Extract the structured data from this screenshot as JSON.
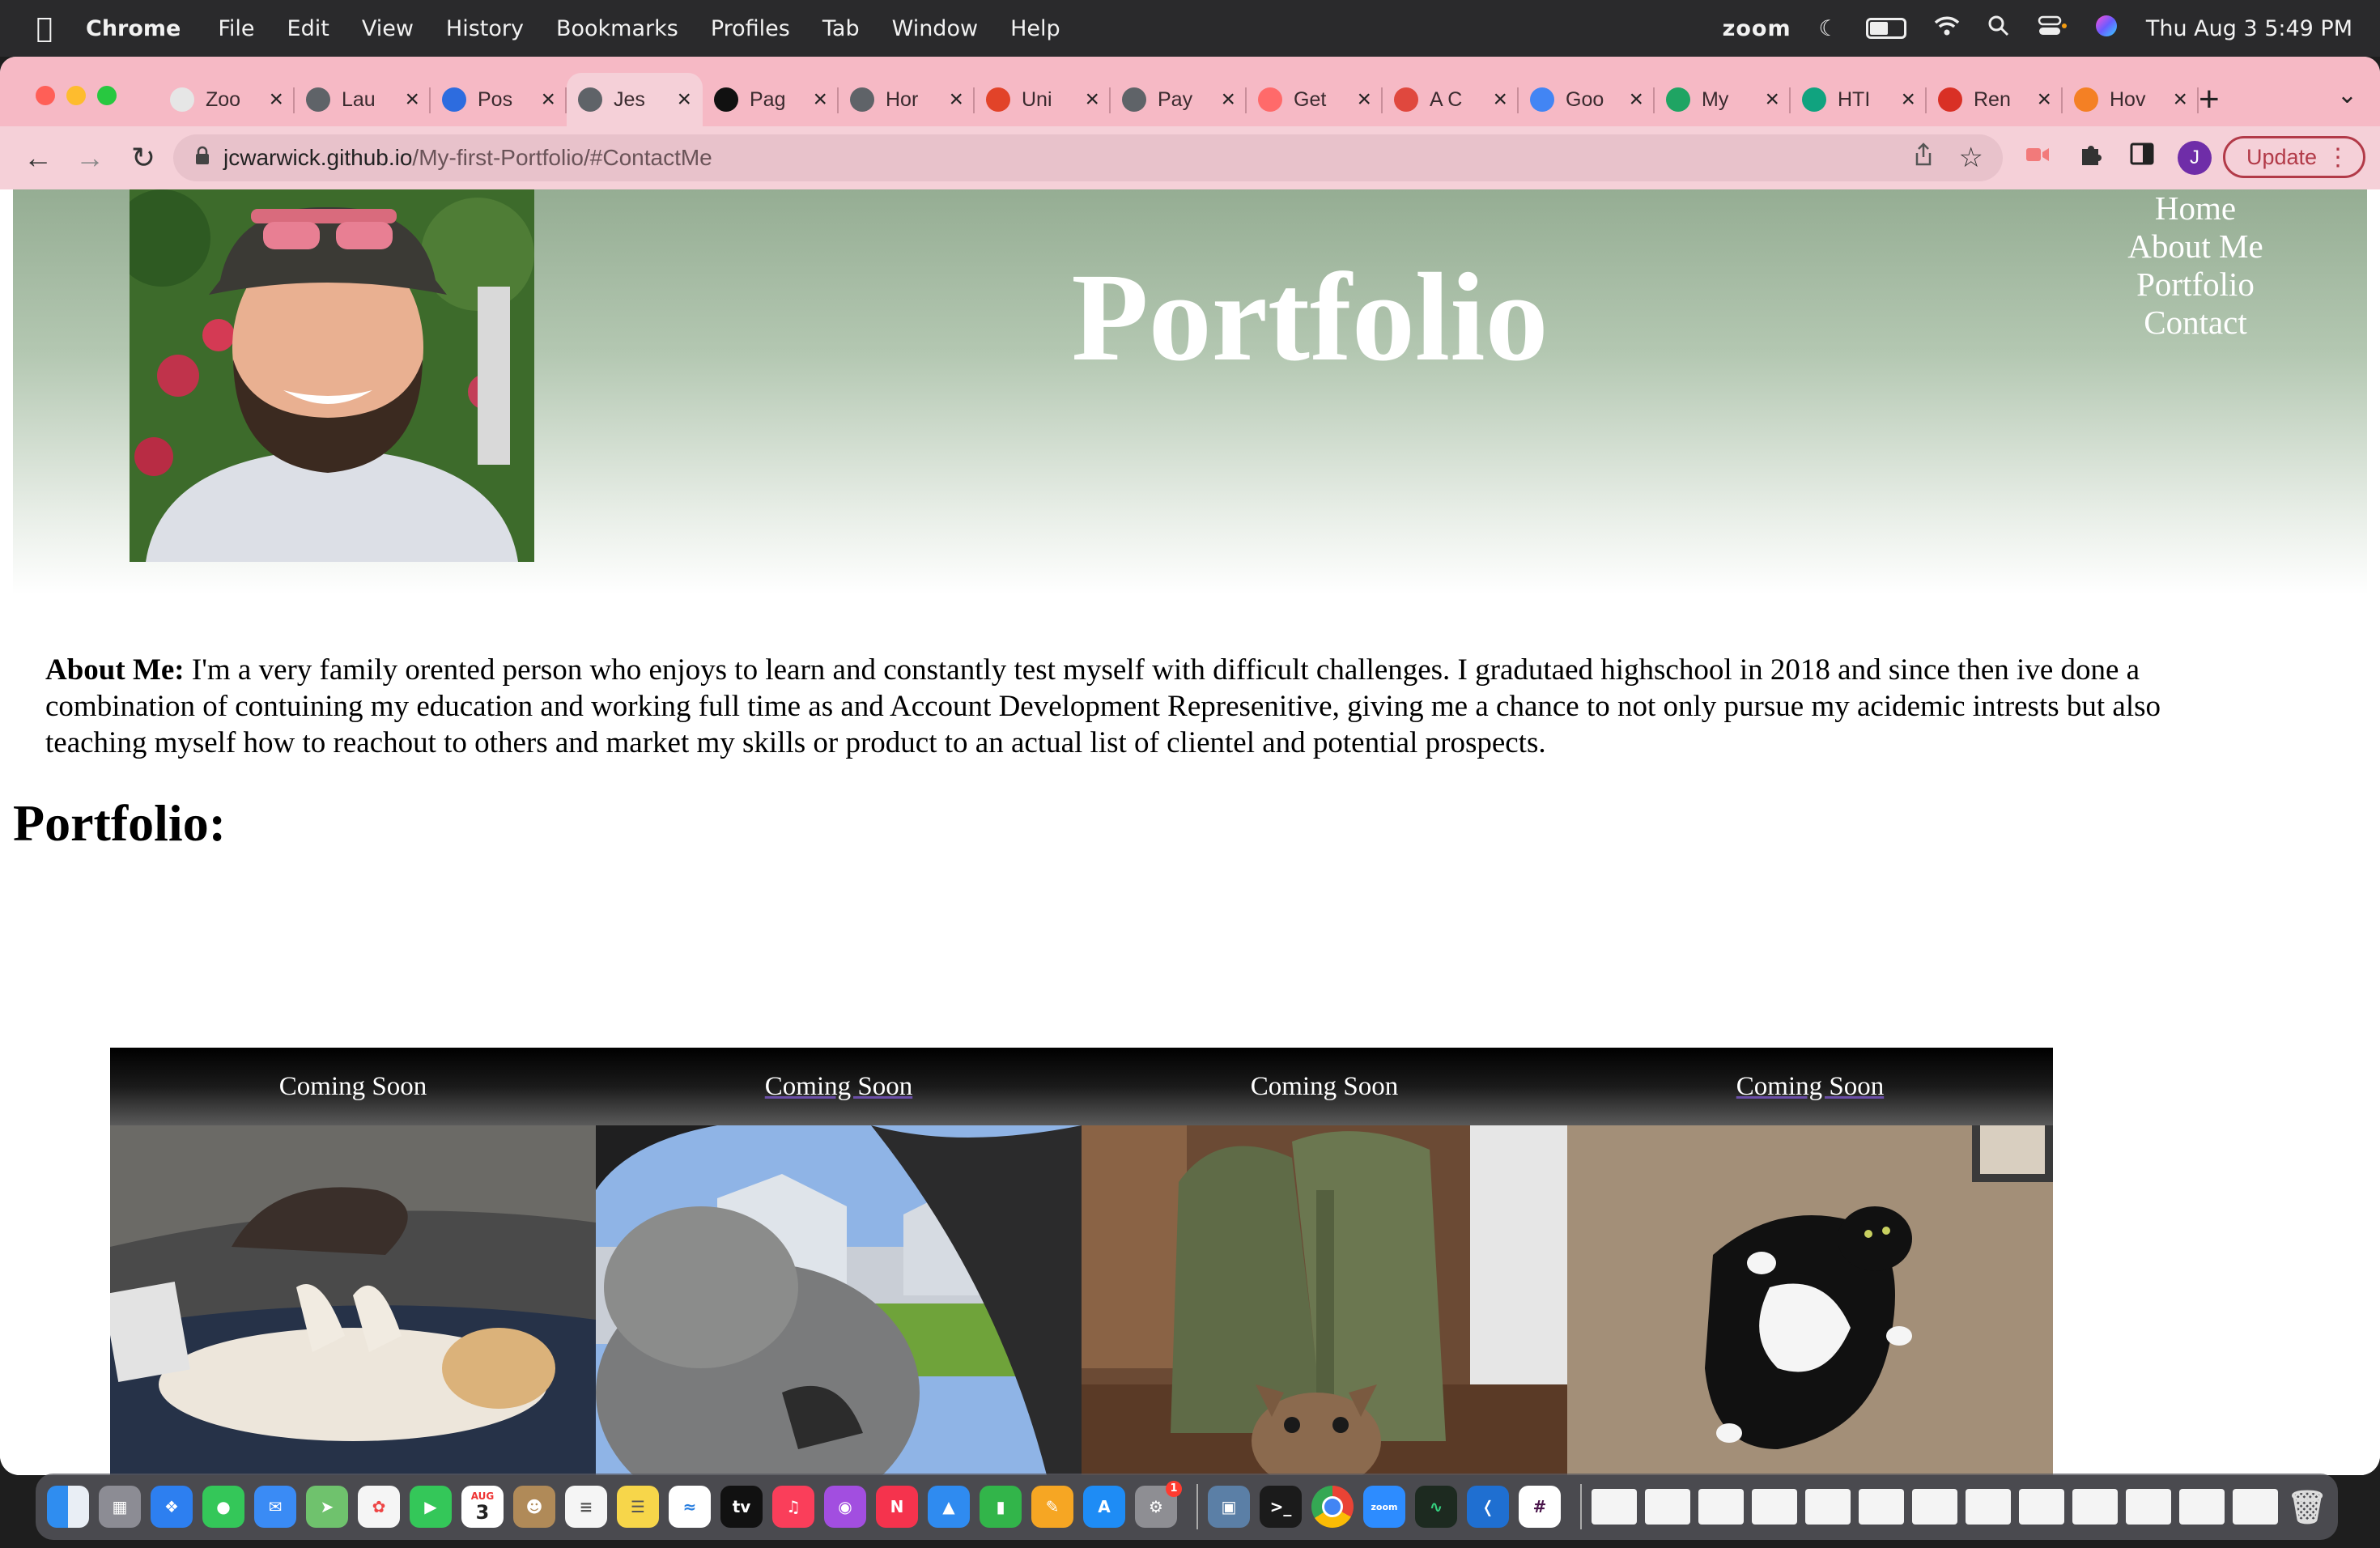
{
  "menubar": {
    "app_name": "Chrome",
    "menus": [
      "File",
      "Edit",
      "View",
      "History",
      "Bookmarks",
      "Profiles",
      "Tab",
      "Window",
      "Help"
    ],
    "status_zoom": "zoom",
    "datetime": "Thu Aug 3  5:49 PM"
  },
  "browser": {
    "tabs": [
      {
        "title": "Zoo",
        "icon": "zoom-icon",
        "color": "#e6e6e6"
      },
      {
        "title": "Lau",
        "icon": "globe-icon",
        "color": "#5f6368"
      },
      {
        "title": "Pos",
        "icon": "z-icon",
        "color": "#2d6cdf"
      },
      {
        "title": "Jes",
        "icon": "globe-icon",
        "color": "#5f6368",
        "active": true
      },
      {
        "title": "Pag",
        "icon": "github-icon",
        "color": "#111111"
      },
      {
        "title": "Hor",
        "icon": "globe-icon",
        "color": "#5f6368"
      },
      {
        "title": "Uni",
        "icon": "gitlab-icon",
        "color": "#e24329"
      },
      {
        "title": "Pay",
        "icon": "globe-icon",
        "color": "#5f6368"
      },
      {
        "title": "Get",
        "icon": "record-icon",
        "color": "#ff6a6a"
      },
      {
        "title": "A C",
        "icon": "asterisk-icon",
        "color": "#e0483e"
      },
      {
        "title": "Goo",
        "icon": "google-icon",
        "color": "#4285f4"
      },
      {
        "title": "My",
        "icon": "drive-icon",
        "color": "#1fa463"
      },
      {
        "title": "HTI",
        "icon": "openai-icon",
        "color": "#10a37f"
      },
      {
        "title": "Ren",
        "icon": "gmail-icon",
        "color": "#d93025"
      },
      {
        "title": "Hov",
        "icon": "stackoverflow-icon",
        "color": "#f48024"
      }
    ],
    "url_host": "jcwarwick.github.io",
    "url_path": "/My-first-Portfolio/#ContactMe",
    "profile_initial": "J",
    "update_label": "Update"
  },
  "page": {
    "title": "Portfolio",
    "nav": [
      "Home",
      "About Me",
      "Portfolio",
      "Contact"
    ],
    "about_label": "About Me:",
    "about_text": " I'm a very family orented person who enjoys to learn and constantly test myself with difficult challenges. I gradutaed highschool in 2018 and since then ive done a combination of contuining my education and working full time as and Account Development Represenitive, giving me a chance to not only pursue my acidemic intrests but also teaching myself how to reachout to others and market my skills or product to an actual list of clientel and potential prospects.",
    "portfolio_heading": "Portfolio:",
    "projects": [
      {
        "caption": "Coming Soon",
        "image": "sleeping-dog-photo"
      },
      {
        "caption": "Coming Soon",
        "image": "dog-in-car-photo"
      },
      {
        "caption": "Coming Soon",
        "image": "bulldog-and-bags-photo"
      },
      {
        "caption": "Coming Soon",
        "image": "tuxedo-cat-photo"
      }
    ]
  },
  "dock": {
    "calendar_month": "AUG",
    "calendar_day": "3",
    "settings_badge": "1"
  }
}
